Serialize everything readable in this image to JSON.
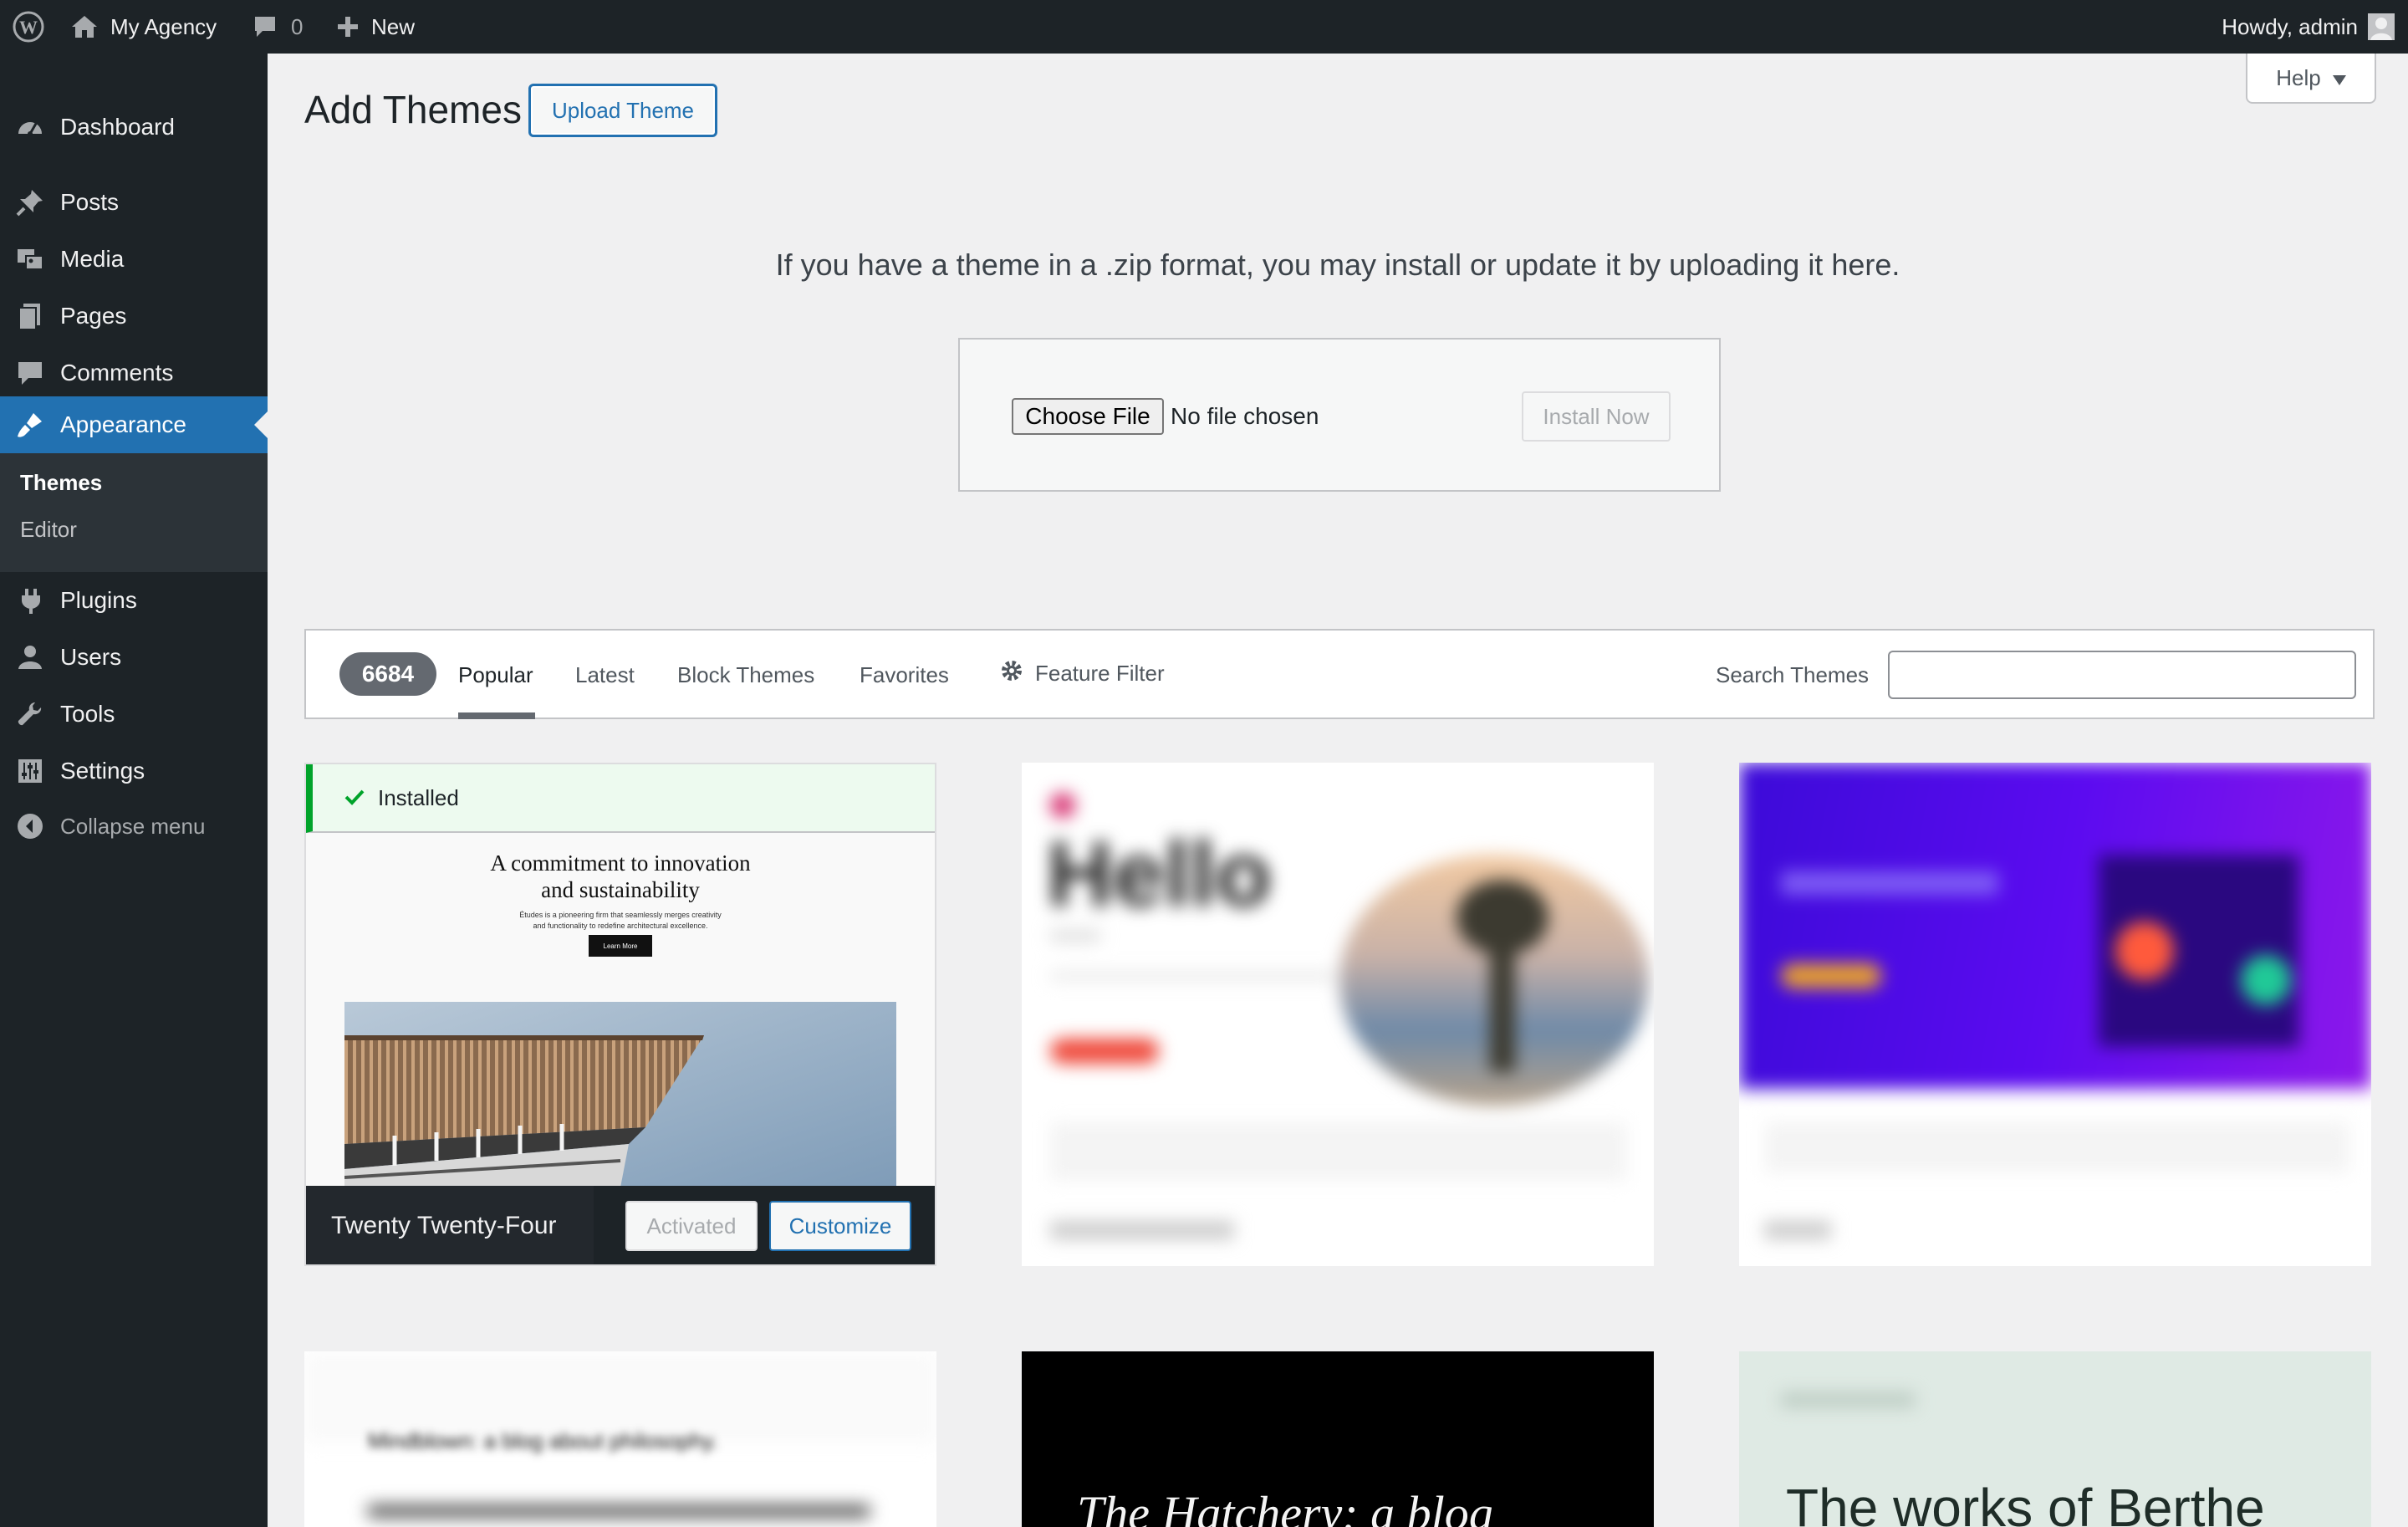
{
  "admin_bar": {
    "site_name": "My Agency",
    "comments_count": "0",
    "new_label": "New",
    "greeting": "Howdy, admin"
  },
  "sidebar": {
    "items": [
      {
        "label": "Dashboard",
        "icon": "dashboard-icon"
      },
      {
        "label": "Posts",
        "icon": "pushpin-icon"
      },
      {
        "label": "Media",
        "icon": "media-icon"
      },
      {
        "label": "Pages",
        "icon": "pages-icon"
      },
      {
        "label": "Comments",
        "icon": "comment-icon"
      },
      {
        "label": "Appearance",
        "icon": "paintbrush-icon",
        "current": true
      },
      {
        "label": "Plugins",
        "icon": "plugin-icon"
      },
      {
        "label": "Users",
        "icon": "user-icon"
      },
      {
        "label": "Tools",
        "icon": "wrench-icon"
      },
      {
        "label": "Settings",
        "icon": "settings-icon"
      }
    ],
    "submenu": [
      {
        "label": "Themes",
        "current": true
      },
      {
        "label": "Editor"
      }
    ],
    "collapse_label": "Collapse menu"
  },
  "help": {
    "label": "Help"
  },
  "page": {
    "title": "Add Themes",
    "upload_button": "Upload Theme",
    "upload_description": "If you have a theme in a .zip format, you may install or update it by uploading it here.",
    "choose_file": "Choose File",
    "no_file": "No file chosen",
    "install_now": "Install Now"
  },
  "filter_bar": {
    "count": "6684",
    "tabs": [
      "Popular",
      "Latest",
      "Block Themes",
      "Favorites"
    ],
    "active_tab": "Popular",
    "feature_filter": "Feature Filter",
    "search_label": "Search Themes",
    "search_value": ""
  },
  "themes": {
    "installed": {
      "notice": "Installed",
      "headline_line1": "A commitment to innovation",
      "headline_line2": "and sustainability",
      "sub_line1": "Études is a pioneering firm that seamlessly merges creativity",
      "sub_line2": "and functionality to redefine architectural excellence.",
      "preview_button": "Learn More",
      "name": "Twenty Twenty-Four",
      "activated": "Activated",
      "customize": "Customize"
    },
    "card2": {
      "preview_title": "Hello"
    },
    "row2": {
      "card1_text": "Mindblown: a blog about philosophy.",
      "card2_text": "The Hatchery: a blog",
      "card3_text": "The works of Berthe"
    }
  },
  "colors": {
    "admin_dark": "#1d2327",
    "accent_blue": "#2271b1",
    "success_green": "#00a32a"
  }
}
